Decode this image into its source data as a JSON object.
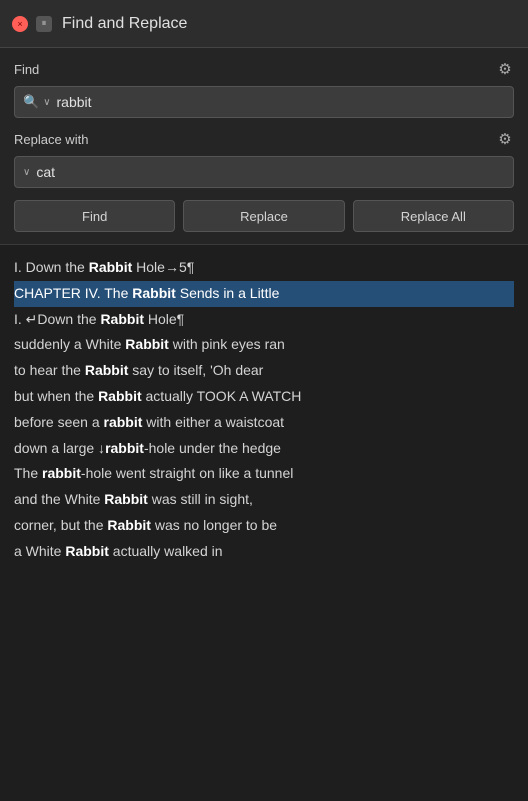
{
  "titlebar": {
    "title": "Find and Replace",
    "close_label": "×",
    "pause_label": "⏸"
  },
  "find_section": {
    "label": "Find",
    "gear_icon": "⚙",
    "search_icon": "🔍",
    "dropdown_arrow": "∨",
    "input_value": "rabbit"
  },
  "replace_section": {
    "label": "Replace with",
    "gear_icon": "⚙",
    "dropdown_arrow": "∨",
    "input_value": "cat"
  },
  "buttons": {
    "find": "Find",
    "replace": "Replace",
    "replace_all": "Replace All"
  },
  "results": [
    {
      "id": "line1",
      "highlighted": false,
      "text_parts": [
        {
          "text": "I. Down the ",
          "bold": false
        },
        {
          "text": "Rabbit",
          "bold": true
        },
        {
          "text": " Hole→5¶",
          "bold": false
        }
      ]
    },
    {
      "id": "line2",
      "highlighted": true,
      "text_parts": [
        {
          "text": "CHAPTER IV. The ",
          "bold": false
        },
        {
          "text": "Rabbit",
          "bold": true
        },
        {
          "text": " Sends in a Little",
          "bold": false
        }
      ]
    },
    {
      "id": "line3",
      "highlighted": false,
      "text_parts": [
        {
          "text": "I. ↵Down the ",
          "bold": false
        },
        {
          "text": "Rabbit",
          "bold": true
        },
        {
          "text": " Hole¶",
          "bold": false
        }
      ]
    },
    {
      "id": "line4",
      "highlighted": false,
      "text_parts": [
        {
          "text": "suddenly a White ",
          "bold": false
        },
        {
          "text": "Rabbit",
          "bold": true
        },
        {
          "text": " with pink eyes ran",
          "bold": false
        }
      ]
    },
    {
      "id": "line5",
      "highlighted": false,
      "text_parts": [
        {
          "text": "to hear the ",
          "bold": false
        },
        {
          "text": "Rabbit",
          "bold": true
        },
        {
          "text": " say to itself, 'Oh dear",
          "bold": false
        }
      ]
    },
    {
      "id": "line6",
      "highlighted": false,
      "text_parts": [
        {
          "text": "but when the ",
          "bold": false
        },
        {
          "text": "Rabbit",
          "bold": true
        },
        {
          "text": " actually TOOK A WATCH",
          "bold": false
        }
      ]
    },
    {
      "id": "line7",
      "highlighted": false,
      "text_parts": [
        {
          "text": "before seen a ",
          "bold": false
        },
        {
          "text": "rabbit",
          "bold": true
        },
        {
          "text": " with either a waistcoat",
          "bold": false
        }
      ]
    },
    {
      "id": "line8",
      "highlighted": false,
      "text_parts": [
        {
          "text": "down a large ↓",
          "bold": false
        },
        {
          "text": "rabbit",
          "bold": true
        },
        {
          "text": "-hole under the hedge",
          "bold": false
        }
      ]
    },
    {
      "id": "line9",
      "highlighted": false,
      "text_parts": [
        {
          "text": "The ",
          "bold": false
        },
        {
          "text": "rabbit",
          "bold": true
        },
        {
          "text": "-hole went straight on like a tunnel",
          "bold": false
        }
      ]
    },
    {
      "id": "line10",
      "highlighted": false,
      "text_parts": [
        {
          "text": "and the White ",
          "bold": false
        },
        {
          "text": "Rabbit",
          "bold": true
        },
        {
          "text": " was still in sight,",
          "bold": false
        }
      ]
    },
    {
      "id": "line11",
      "highlighted": false,
      "text_parts": [
        {
          "text": "corner, but the ",
          "bold": false
        },
        {
          "text": "Rabbit",
          "bold": true
        },
        {
          "text": " was no longer to be",
          "bold": false
        }
      ]
    },
    {
      "id": "line12",
      "highlighted": false,
      "text_parts": [
        {
          "text": "a White ",
          "bold": false
        },
        {
          "text": "Rabbit",
          "bold": true
        },
        {
          "text": " actually walked in",
          "bold": false
        }
      ]
    }
  ]
}
